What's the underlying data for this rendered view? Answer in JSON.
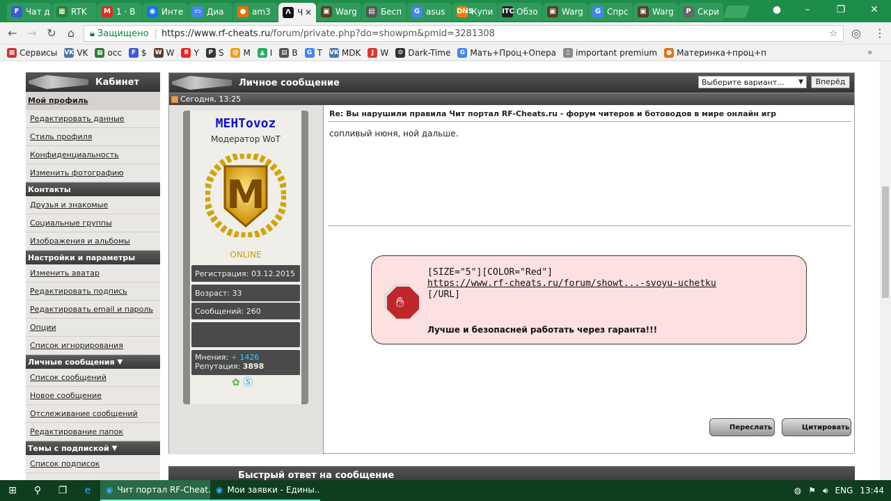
{
  "browser": {
    "tabs": [
      {
        "icon": "F",
        "color": "#3b5bdb",
        "label": "Чат д"
      },
      {
        "icon": "▦",
        "color": "#2e7d32",
        "label": "RTK"
      },
      {
        "icon": "M",
        "color": "#d93025",
        "label": "1 · В"
      },
      {
        "icon": "◉",
        "color": "#1a73e8",
        "label": "Инте"
      },
      {
        "icon": "▭",
        "color": "#4285f4",
        "label": "Диа"
      },
      {
        "icon": "●",
        "color": "#e8710a",
        "label": "am3"
      },
      {
        "icon": "Ʌ",
        "color": "#111",
        "label": "Ч",
        "active": true
      },
      {
        "icon": "▣",
        "color": "#5a3d2b",
        "label": "Warg"
      },
      {
        "icon": "▤",
        "color": "#555",
        "label": "Бесп"
      },
      {
        "icon": "G",
        "color": "#4285f4",
        "label": "asus"
      },
      {
        "icon": "DNS",
        "color": "#f57c00",
        "label": "Купи"
      },
      {
        "icon": "ITC",
        "color": "#222",
        "label": "Обзо"
      },
      {
        "icon": "▣",
        "color": "#5a3d2b",
        "label": "Warg"
      },
      {
        "icon": "G",
        "color": "#4285f4",
        "label": "Спрс"
      },
      {
        "icon": "▣",
        "color": "#5a3d2b",
        "label": "Warg"
      },
      {
        "icon": "P",
        "color": "#666",
        "label": "Скри"
      }
    ],
    "secure_label": "Защищено",
    "url_host": "https://www.rf-cheats.ru",
    "url_path": "/forum/private.php?do=showpm&pmid=3281308",
    "bookmarks": [
      {
        "icon": "▦",
        "color": "#c33",
        "label": "Сервисы"
      },
      {
        "icon": "VK",
        "color": "#4a76a8",
        "label": "VK"
      },
      {
        "icon": "▦",
        "color": "#2e7d32",
        "label": "осс"
      },
      {
        "icon": "F",
        "color": "#3b5bdb",
        "label": "$"
      },
      {
        "icon": "W",
        "color": "#5a3d2b",
        "label": "W"
      },
      {
        "icon": "Я",
        "color": "#e22",
        "label": "Y"
      },
      {
        "icon": "P",
        "color": "#333",
        "label": "S"
      },
      {
        "icon": "@",
        "color": "#f39c12",
        "label": "M"
      },
      {
        "icon": "▲",
        "color": "#27ae60",
        "label": "I"
      },
      {
        "icon": "▤",
        "color": "#555",
        "label": "B"
      },
      {
        "icon": "G",
        "color": "#4285f4",
        "label": "T"
      },
      {
        "icon": "VK",
        "color": "#4a76a8",
        "label": "MDK"
      },
      {
        "icon": "J",
        "color": "#d33",
        "label": "W"
      },
      {
        "icon": "⚙",
        "color": "#333",
        "label": "Dark-Time"
      },
      {
        "icon": "G",
        "color": "#4285f4",
        "label": "Мать+Проц+Опера"
      },
      {
        "icon": "▯",
        "color": "#888",
        "label": "important premium"
      },
      {
        "icon": "●",
        "color": "#e8710a",
        "label": "Материнка+проц+п"
      }
    ]
  },
  "sidebar": {
    "title": "Кабинет",
    "profile": [
      "Мой профиль",
      "Редактировать данные",
      "Стиль профиля",
      "Конфиденциальность",
      "Изменить фотографию"
    ],
    "contacts_title": "Контакты",
    "contacts": [
      "Друзья и знакомые",
      "Социальные группы",
      "Изображения и альбомы"
    ],
    "settings_title": "Настройки и параметры",
    "settings": [
      "Изменить аватар",
      "Редактировать подпись",
      "Редактировать email и пароль",
      "Опции",
      "Список игнорирования"
    ],
    "pm_title": "Личные сообщения",
    "pm": [
      "Список сообщений",
      "Новое сообщение",
      "Отслеживание сообщений",
      "Редактирование папок"
    ],
    "subs_title": "Темы с подпиской",
    "subs": [
      "Список подписок"
    ]
  },
  "main": {
    "title": "Личное сообщение",
    "select_value": "Выберите вариант...",
    "go_label": "Вперёд",
    "date": "Сегодня, 13:25",
    "user": {
      "name": "MEHTovoz",
      "rank": "Модератор WoT",
      "badge_letter": "M",
      "status": "ONLINE",
      "registration": "Регистрация: 03.12.2015",
      "age": "Возраст: 33",
      "posts": "Сообщений: 260",
      "opinions_label": "Мнения:",
      "opinions_value": "+ 1426",
      "reputation_label": "Репутация:",
      "reputation_value": "3898"
    },
    "message": {
      "title": "Re: Вы нарушили правила Чит портал RF-Cheats.ru - форум читеров и ботоводов в мире онлайн игр",
      "body": "сопливый нюня, ной дальше.",
      "alert_line1": "[SIZE=\"5\"][COLOR=\"Red\"]",
      "alert_link": "https://www.rf-cheats.ru/forum/showt...-svoyu-uchetku",
      "alert_line3": "[/URL]",
      "alert_bold": "Лучше и безопасней работать через гаранта!!!"
    },
    "forward_label": "Переслать",
    "quote_label": "Цитировать",
    "quick_reply_title": "Быстрый ответ на сообщение"
  },
  "taskbar": {
    "apps": [
      {
        "label": "Чит портал RF-Cheat...",
        "active": true
      },
      {
        "label": "Мои заявки - Едины...",
        "active": false
      }
    ],
    "lang": "ENG",
    "time": "13:44"
  }
}
